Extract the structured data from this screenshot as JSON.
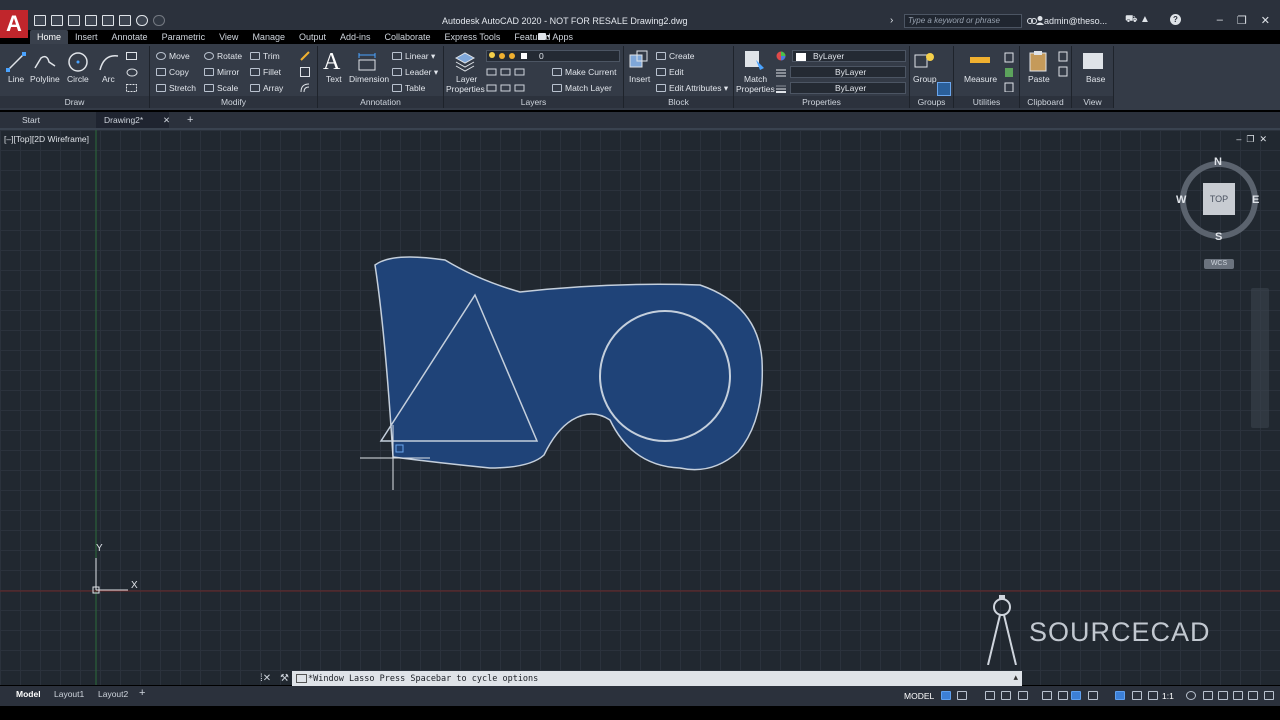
{
  "titlebar": {
    "app_logo": "A",
    "title": "Autodesk AutoCAD 2020 - NOT FOR RESALE    Drawing2.dwg",
    "search_placeholder": "Type a keyword or phrase",
    "user": "admin@theso..."
  },
  "ribbon_tabs": [
    "Home",
    "Insert",
    "Annotate",
    "Parametric",
    "View",
    "Manage",
    "Output",
    "Add-ins",
    "Collaborate",
    "Express Tools",
    "Featured Apps"
  ],
  "ribbon": {
    "draw": {
      "title": "Draw",
      "line": "Line",
      "polyline": "Polyline",
      "circle": "Circle",
      "arc": "Arc"
    },
    "modify": {
      "title": "Modify",
      "move": "Move",
      "rotate": "Rotate",
      "trim": "Trim",
      "copy": "Copy",
      "mirror": "Mirror",
      "fillet": "Fillet",
      "stretch": "Stretch",
      "scale": "Scale",
      "array": "Array"
    },
    "annotation": {
      "title": "Annotation",
      "text": "Text",
      "dimension": "Dimension",
      "linear": "Linear",
      "leader": "Leader",
      "table": "Table"
    },
    "layers": {
      "title": "Layers",
      "layer_properties_1": "Layer",
      "layer_properties_2": "Properties",
      "current_layer": "0",
      "make_current": "Make Current",
      "match_layer": "Match Layer"
    },
    "block": {
      "title": "Block",
      "insert": "Insert",
      "create": "Create",
      "edit": "Edit",
      "edit_attributes": "Edit Attributes"
    },
    "properties": {
      "title": "Properties",
      "match_1": "Match",
      "match_2": "Properties",
      "color": "ByLayer",
      "linetype": "ByLayer",
      "lineweight": "ByLayer"
    },
    "groups": {
      "title": "Groups",
      "group": "Group"
    },
    "utilities": {
      "title": "Utilities",
      "measure": "Measure"
    },
    "clipboard": {
      "title": "Clipboard",
      "paste": "Paste"
    },
    "view": {
      "title": "View",
      "base": "Base"
    }
  },
  "doc_tabs": {
    "start": "Start",
    "drawing": "Drawing2*"
  },
  "viewport": {
    "label": "[–][Top][2D Wireframe]",
    "viewcube": {
      "top": "TOP",
      "n": "N",
      "s": "S",
      "e": "E",
      "w": "W",
      "wcs": "WCS"
    },
    "ucs": {
      "x": "X",
      "y": "Y"
    },
    "watermark": "SOURCECAD"
  },
  "command_line": "*Window Lasso  Press Spacebar to cycle options",
  "status": {
    "model_tab": "Model",
    "layout1": "Layout1",
    "layout2": "Layout2",
    "model": "MODEL",
    "scale": "1:1"
  },
  "colors": {
    "selection_fill": "#1f4378",
    "selection_edge": "#c4cfdc",
    "logo_red": "#c0262c",
    "grid_line": "#2b323c",
    "x_axis": "#8b2a2a",
    "y_axis": "#2c6b3a"
  }
}
